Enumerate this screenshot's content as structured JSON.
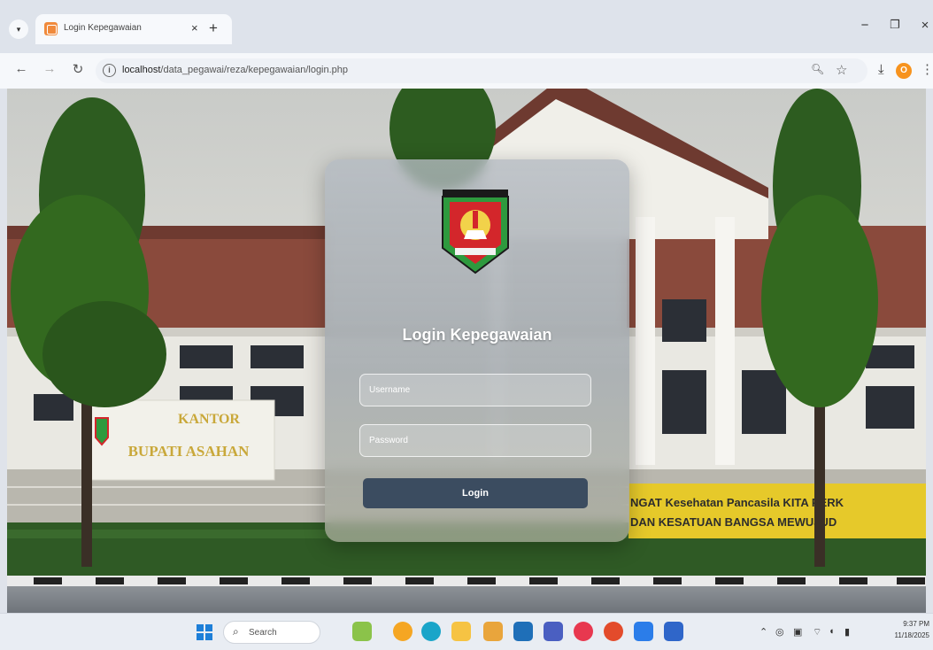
{
  "browser": {
    "tab_title": "Login Kepegawaian",
    "tab_close": "×",
    "new_tab": "+",
    "url_host": "localhost",
    "url_path": "/data_pegawai/reza/kepegawaian/login.php",
    "profile_initial": "O",
    "window_minimize": "−",
    "window_restore": "❐",
    "window_close": "×"
  },
  "login": {
    "title": "Login Kepegawaian",
    "username_placeholder": "Username",
    "password_placeholder": "Password",
    "submit_label": "Login"
  },
  "scene": {
    "sign_line1": "KANTOR",
    "sign_line2": "BUPATI ASAHAN",
    "banner_line1": "NGAT Kesehatan Pancasila KITA PERK",
    "banner_line2": "DAN KESATUAN BANGSA MEWUJUD"
  },
  "taskbar": {
    "search_label": "Search",
    "time": "9:37 PM",
    "date": "11/18/2025"
  },
  "colors": {
    "login_button": "#3b4c60",
    "emblem_green": "#2e9a3e",
    "emblem_red": "#d3262b",
    "banner_yellow": "#e6c92a"
  }
}
